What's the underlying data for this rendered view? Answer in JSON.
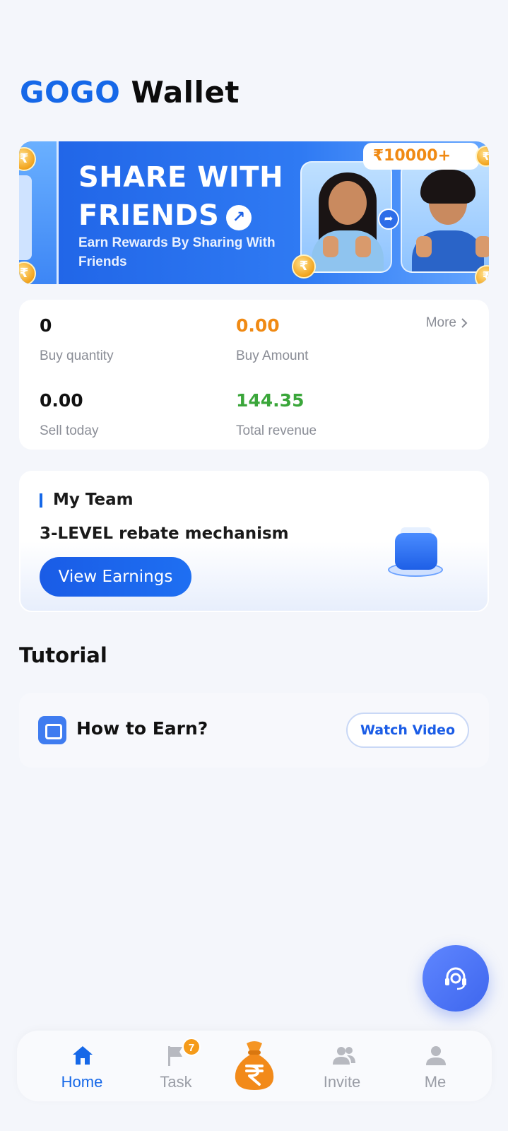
{
  "app": {
    "brand": "GOGO",
    "title_rest": "Wallet"
  },
  "banner": {
    "headline_line1": "SHARE WITH",
    "headline_line2": "FRIENDS",
    "subtitle": "Earn Rewards By Sharing With Friends",
    "reward_badge": "₹10000+",
    "coin_symbol": "₹"
  },
  "stats": {
    "more_label": "More",
    "buy_quantity": {
      "value": "0",
      "label": "Buy quantity"
    },
    "buy_amount": {
      "value": "0.00",
      "label": "Buy Amount"
    },
    "sell_today": {
      "value": "0.00",
      "label": "Sell today"
    },
    "total_revenue": {
      "value": "144.35",
      "label": "Total revenue"
    }
  },
  "team": {
    "title": "My Team",
    "description": "3-LEVEL rebate mechanism",
    "button_label": "View Earnings"
  },
  "tutorial": {
    "section_title": "Tutorial",
    "item_label": "How to Earn?",
    "button_label": "Watch Video"
  },
  "nav": {
    "items": [
      {
        "label": "Home",
        "icon": "home-icon",
        "active": true
      },
      {
        "label": "Task",
        "icon": "flag-icon",
        "badge": "7"
      },
      {
        "label": "",
        "icon": "money-bag-icon"
      },
      {
        "label": "Invite",
        "icon": "people-icon"
      },
      {
        "label": "Me",
        "icon": "user-icon"
      }
    ]
  },
  "colors": {
    "brand_blue": "#1668e8",
    "amount_orange": "#f08a14",
    "revenue_green": "#3aa63a",
    "badge_orange": "#f59b1a"
  }
}
